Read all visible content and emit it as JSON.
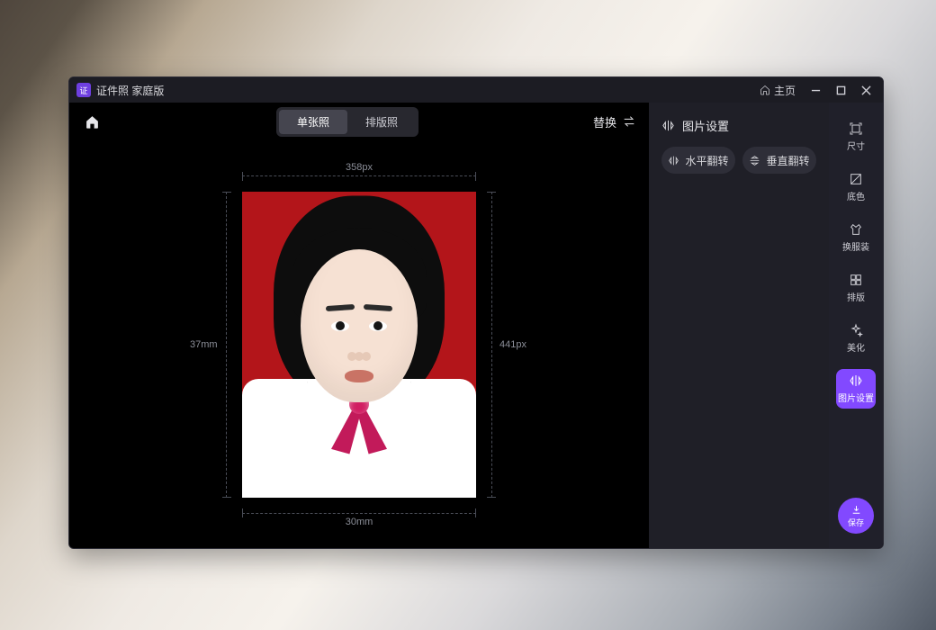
{
  "titlebar": {
    "app_title": "证件照 家庭版",
    "main_page_label": "主页"
  },
  "toolbar": {
    "tab_single": "单张照",
    "tab_layout": "排版照",
    "replace_label": "替换"
  },
  "canvas": {
    "dims": {
      "top_label": "358px",
      "right_label": "441px",
      "bottom_label": "30mm",
      "left_label": "37mm"
    }
  },
  "panel": {
    "title": "图片设置",
    "flip_h_label": "水平翻转",
    "flip_v_label": "垂直翻转"
  },
  "rail": {
    "items": [
      {
        "id": "size",
        "label": "尺寸"
      },
      {
        "id": "bgcolor",
        "label": "底色"
      },
      {
        "id": "clothing",
        "label": "换服装"
      },
      {
        "id": "layout",
        "label": "排版"
      },
      {
        "id": "beautify",
        "label": "美化"
      },
      {
        "id": "image",
        "label": "图片设置"
      }
    ],
    "save_label": "保存"
  }
}
